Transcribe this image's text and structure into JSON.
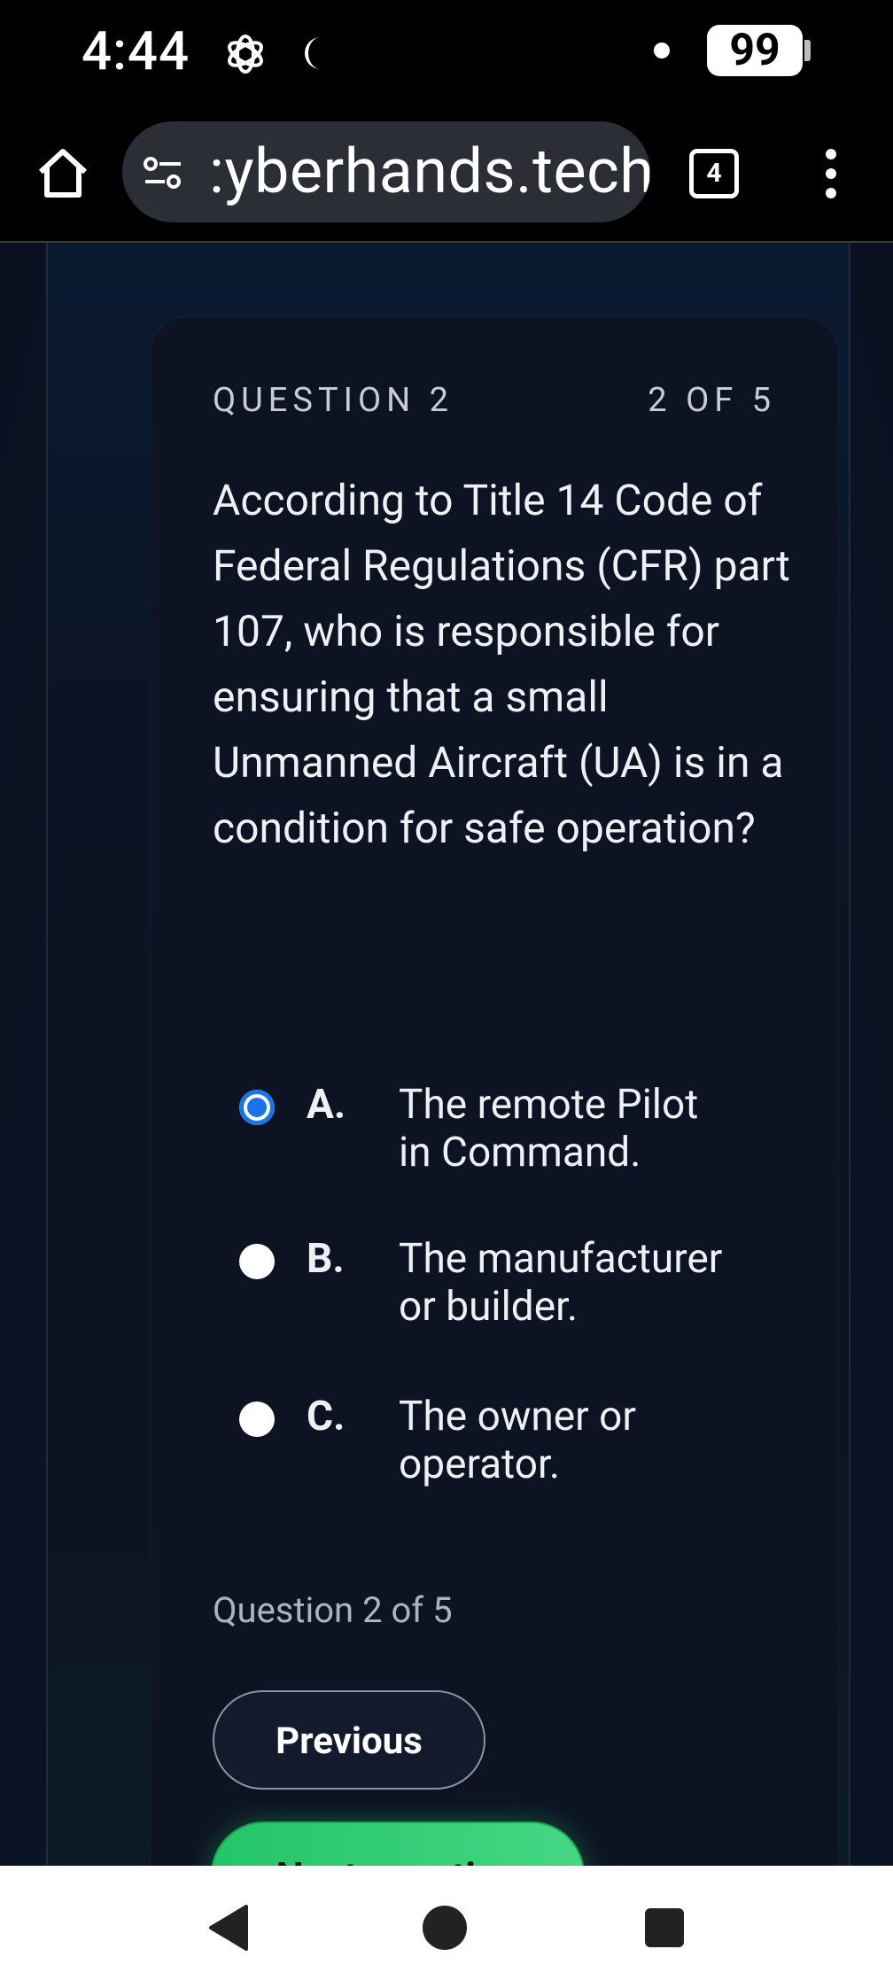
{
  "status_bar": {
    "time": "4:44",
    "battery": "99",
    "icons": [
      "chatgpt-icon",
      "moon-icon",
      "notification-dot"
    ]
  },
  "browser": {
    "url": ":yberhands.tech",
    "tab_count": "4",
    "icons": [
      "home-icon",
      "site-settings-icon",
      "more-vert-icon"
    ]
  },
  "quiz": {
    "question_label": "QUESTION 2",
    "counter": "2 OF 5",
    "question": "According to Title 14 Code of Federal Regulations (CFR) part 107, who is responsible for ensuring that a small Unmanned Aircraft (UA) is in a condition for safe operation?",
    "options": [
      {
        "letter": "A.",
        "text_line1": "The remote Pilot",
        "text_line2": "in Command.",
        "selected": true
      },
      {
        "letter": "B.",
        "text_line1": "The manufacturer",
        "text_line2": "or builder.",
        "selected": false
      },
      {
        "letter": "C.",
        "text_line1": "The owner or",
        "text_line2": "operator.",
        "selected": false
      }
    ],
    "progress_text": "Question 2 of 5",
    "previous_label": "Previous",
    "next_label": "Next question"
  },
  "colors": {
    "selected_radio": "#1a73e8",
    "next_button": "#2ecc71",
    "card_bg": "#0d1322"
  }
}
